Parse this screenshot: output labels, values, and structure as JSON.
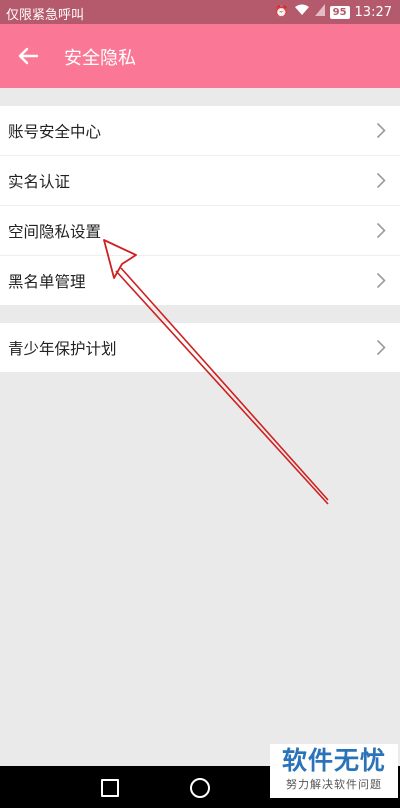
{
  "status_bar": {
    "carrier": "仅限紧急呼叫",
    "battery": "95",
    "time": "13:27",
    "icons": [
      "alarm-icon",
      "wifi-icon",
      "signal-icon",
      "battery-icon"
    ]
  },
  "app_bar": {
    "title": "安全隐私",
    "back_icon": "arrow-left-icon"
  },
  "menu_group1": [
    {
      "label": "账号安全中心"
    },
    {
      "label": "实名认证"
    },
    {
      "label": "空间隐私设置"
    },
    {
      "label": "黑名单管理"
    }
  ],
  "menu_group2": [
    {
      "label": "青少年保护计划"
    }
  ],
  "watermark": {
    "main": "软件无忧",
    "sub": "努力解决软件问题"
  },
  "colors": {
    "status_bar": "#b5596c",
    "app_bar": "#fa7895",
    "background": "#eaeaea",
    "annotation_arrow": "#d02020"
  }
}
